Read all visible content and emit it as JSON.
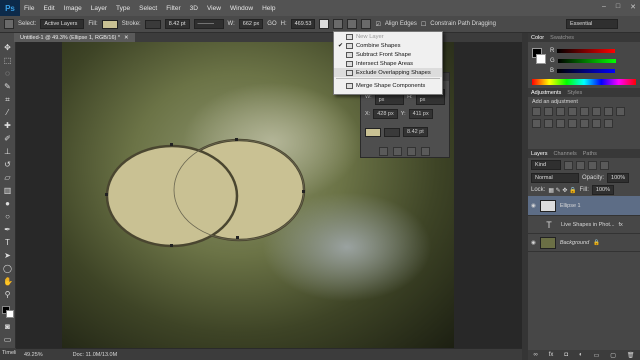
{
  "app": {
    "logo": "Ps"
  },
  "menu": [
    "File",
    "Edit",
    "Image",
    "Layer",
    "Type",
    "Select",
    "Filter",
    "3D",
    "View",
    "Window",
    "Help"
  ],
  "options": {
    "select_label": "Select:",
    "select_value": "Active Layers",
    "fill_label": "Fill:",
    "stroke_label": "Stroke:",
    "stroke_width": "8.42 pt",
    "w_label": "W:",
    "w_value": "662 px",
    "link_label": "GO",
    "h_label": "H:",
    "h_value": "469.53",
    "align_edges": "Align Edges",
    "constrain": "Constrain Path Dragging",
    "workspace": "Essential"
  },
  "document": {
    "tab": "Untitled-1 @ 49.3% (Ellipse 1, RGB/16) *"
  },
  "dropdown": {
    "items": [
      "New Layer",
      "Combine Shapes",
      "Subtract Front Shape",
      "Intersect Shape Areas",
      "Exclude Overlapping Shapes"
    ],
    "merge": "Merge Shape Components",
    "checked_index": 1,
    "highlighted_index": 4
  },
  "properties": {
    "w": "534.25 px",
    "h": "380.55 px",
    "x": "428 px",
    "y": "411 px",
    "stroke": "8.42 pt"
  },
  "status": {
    "zoom": "49.25%",
    "doc": "Doc: 11.0M/13.0M",
    "timeline": "Timeline"
  },
  "color_panel": {
    "tabs": [
      "Color",
      "Swatches"
    ],
    "r": "R",
    "g": "G",
    "b": "B"
  },
  "adjustments": {
    "tabs": [
      "Adjustments",
      "Styles"
    ],
    "title": "Add an adjustment"
  },
  "layers": {
    "tabs": [
      "Layers",
      "Channels",
      "Paths"
    ],
    "kind": "Kind",
    "mode": "Normal",
    "opacity_label": "Opacity:",
    "opacity": "100%",
    "lock_label": "Lock:",
    "fill_label": "Fill:",
    "fill": "100%",
    "items": [
      {
        "name": "Ellipse 1",
        "type": "shape"
      },
      {
        "name": "Live Shapes in Phot...",
        "type": "text"
      },
      {
        "name": "Background",
        "type": "image"
      }
    ]
  },
  "colors": {
    "shape_fill": "#c9c193",
    "accent": "#e03030"
  }
}
